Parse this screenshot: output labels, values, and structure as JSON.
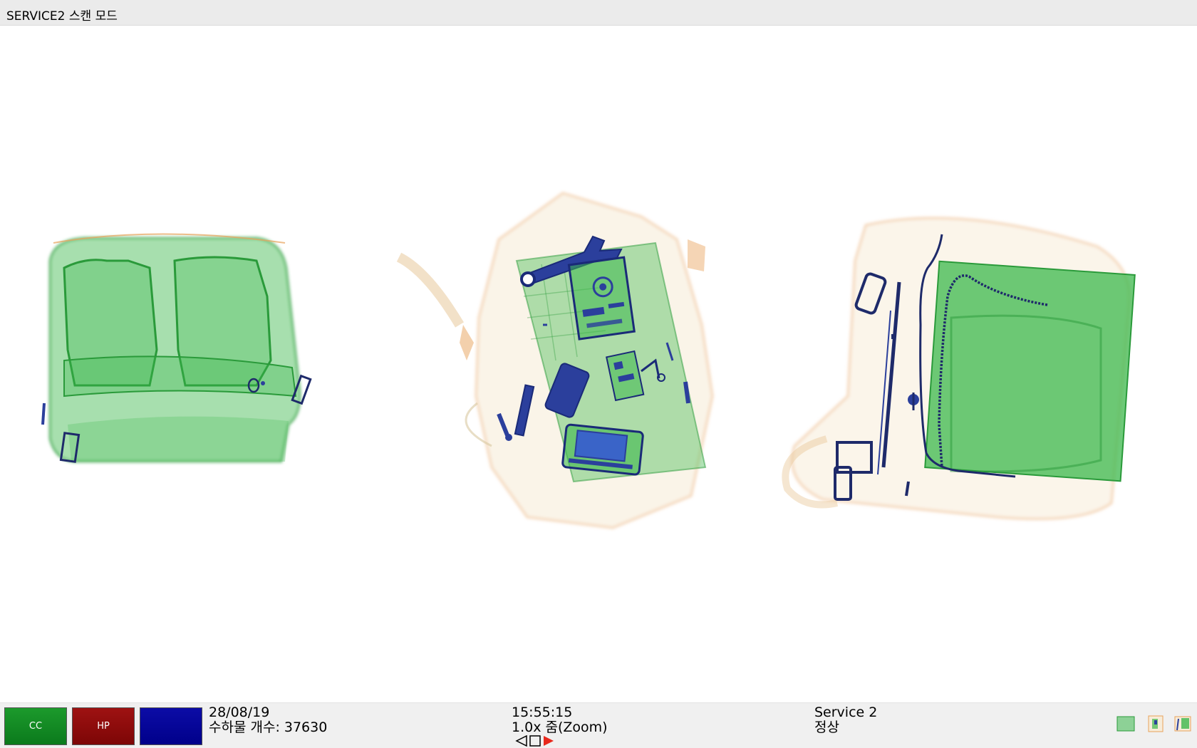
{
  "window": {
    "title": "SERVICE2 스캔 모드"
  },
  "scan": {
    "item_names": [
      "backpack-green",
      "backpack-organic-with-tools",
      "backpack-with-laptop"
    ]
  },
  "toolbar": {
    "buttons": [
      {
        "label": "CC",
        "color": "#118a22"
      },
      {
        "label": "HP",
        "color": "#8a0b0b"
      },
      {
        "label": "",
        "color": "#02029a"
      }
    ]
  },
  "status": {
    "date": "28/08/19",
    "baggage_count": "수하물 개수: 37630",
    "time": "15:55:15",
    "zoom": "1.0x 줌(Zoom)",
    "service": "Service 2",
    "state": "정상"
  },
  "nav": {
    "icons": [
      "triangle-left-outline-icon",
      "square-outline-icon",
      "triangle-right-filled-icon"
    ],
    "accent": "#e8281c"
  },
  "thumbnails": [
    "thumbnail-1",
    "thumbnail-2",
    "thumbnail-3"
  ],
  "colors": {
    "organic": "#e8a25a",
    "inorganic": "#3cb84c",
    "metal": "#2b3f9c"
  }
}
